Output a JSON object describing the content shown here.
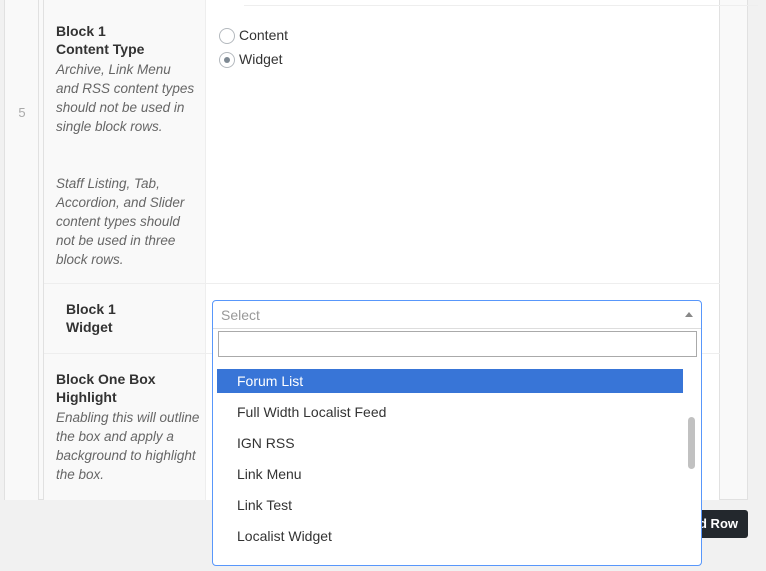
{
  "row_number": "5",
  "block_content_type": {
    "title_line1": "Block 1",
    "title_line2": "Content Type",
    "desc1": "Archive, Link Menu and RSS content types should not be used in single block rows.",
    "desc2": "Staff Listing, Tab, Accordion, and Slider content types should not be used in three block rows.",
    "options": [
      {
        "label": "Content",
        "checked": false
      },
      {
        "label": "Widget",
        "checked": true
      }
    ]
  },
  "block_widget": {
    "title_line1": "Block 1",
    "title_line2": "Widget",
    "select_placeholder": "Select",
    "search_value": "",
    "dropdown_options": [
      {
        "label": "Forum List",
        "active": true
      },
      {
        "label": "Full Width Localist Feed",
        "active": false
      },
      {
        "label": "IGN RSS",
        "active": false
      },
      {
        "label": "Link Menu",
        "active": false
      },
      {
        "label": "Link Test",
        "active": false
      },
      {
        "label": "Localist Widget",
        "active": false
      }
    ]
  },
  "block_highlight": {
    "title_line1": "Block One Box",
    "title_line2": "Highlight",
    "desc": "Enabling this will outline the box and apply a background to highlight the box."
  },
  "footer": {
    "add_row_label": "d Row"
  },
  "colors": {
    "accent": "#3875d7",
    "focus_border": "#5897fb",
    "dark_button": "#23282d"
  }
}
